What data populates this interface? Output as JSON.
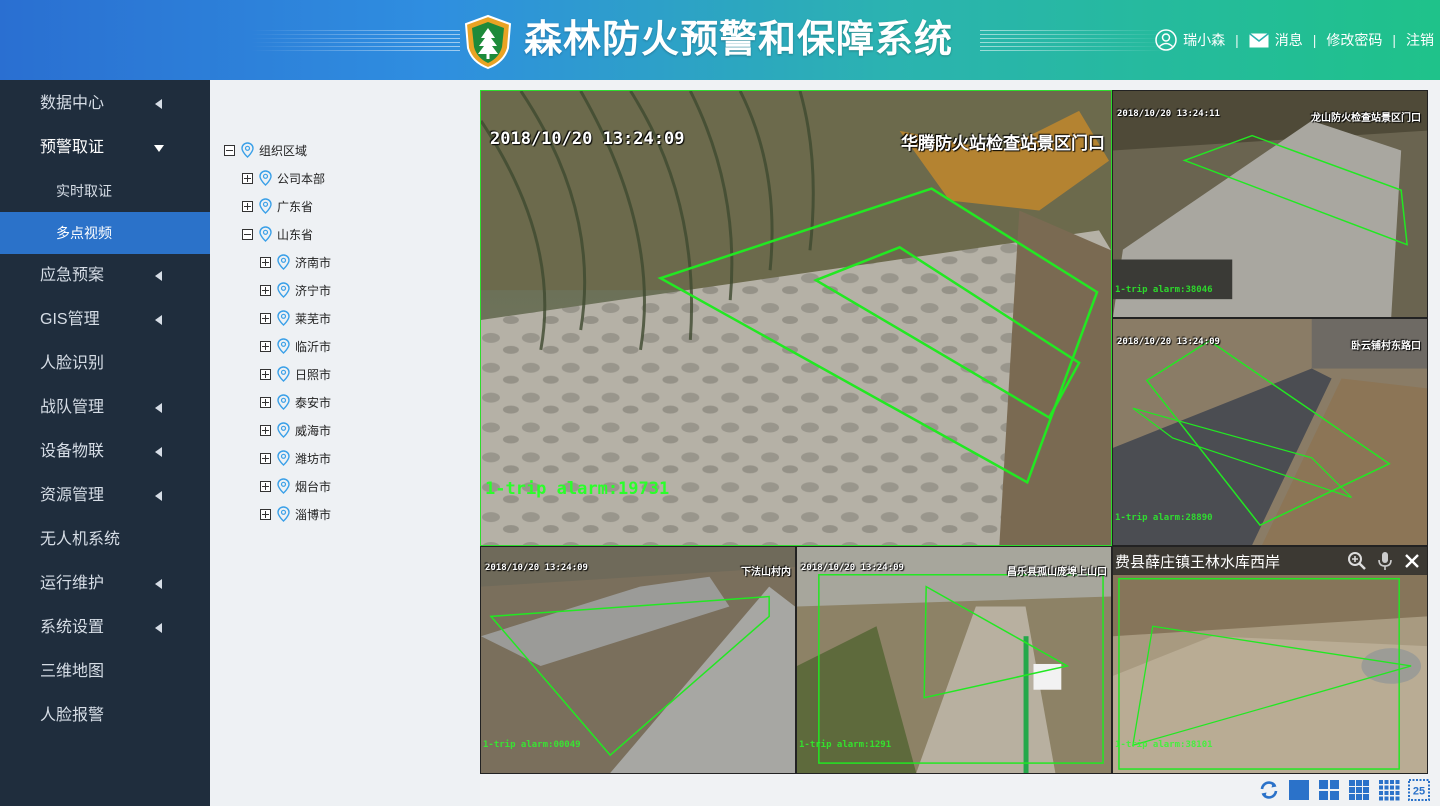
{
  "header": {
    "title": "森林防火预警和保障系统",
    "user_name": "瑞小森",
    "messages_label": "消息",
    "change_password_label": "修改密码",
    "logout_label": "注销",
    "separator": "|"
  },
  "sidebar": {
    "items": [
      {
        "label": "数据中心",
        "has_arrow": true
      },
      {
        "label": "预警取证",
        "open": true
      },
      {
        "label": "应急预案",
        "has_arrow": true
      },
      {
        "label": "GIS管理",
        "has_arrow": true
      },
      {
        "label": "人脸识别",
        "has_arrow": false
      },
      {
        "label": "战队管理",
        "has_arrow": true
      },
      {
        "label": "设备物联",
        "has_arrow": true
      },
      {
        "label": "资源管理",
        "has_arrow": true
      },
      {
        "label": "无人机系统",
        "has_arrow": false
      },
      {
        "label": "运行维护",
        "has_arrow": true
      },
      {
        "label": "系统设置",
        "has_arrow": true
      },
      {
        "label": "三维地图",
        "has_arrow": false
      },
      {
        "label": "人脸报警",
        "has_arrow": false
      }
    ],
    "sub_items": [
      {
        "label": "实时取证",
        "active": false
      },
      {
        "label": "多点视频",
        "active": true
      }
    ]
  },
  "tree": {
    "root": "组织区域",
    "level1": [
      "公司本部",
      "广东省",
      "山东省"
    ],
    "shandong_cities": [
      "济南市",
      "济宁市",
      "莱芜市",
      "临沂市",
      "日照市",
      "泰安市",
      "威海市",
      "潍坊市",
      "烟台市",
      "淄博市"
    ]
  },
  "cameras": {
    "main": {
      "time": "2018/10/20 13:24:09",
      "name": "华腾防火站检查站景区门口",
      "alarm": "1-trip alarm:19731"
    },
    "c2": {
      "time": "2018/10/20 13:24:11",
      "name": "龙山防火检查站景区门口",
      "alarm": "1-trip alarm:38046"
    },
    "c3": {
      "time": "2018/10/20 13:24:09",
      "name": "卧云铺村东路口",
      "alarm": "1-trip alarm:28890"
    },
    "c4": {
      "time": "2018/10/20 13:24:09",
      "name": "下法山村内",
      "alarm": "1-trip alarm:00049"
    },
    "c5": {
      "time": "2018/10/20 13:24:09",
      "name": "昌乐县孤山庞埠上山口",
      "alarm": "1-trip alarm:1291"
    },
    "c6": {
      "title": "费县薛庄镇王林水库西岸",
      "alarm": "1-trip alarm:38101"
    }
  },
  "colors": {
    "accent": "#2b72c9",
    "sidebar_bg": "#1f2d3d",
    "alarm_green": "#2aff2a"
  }
}
